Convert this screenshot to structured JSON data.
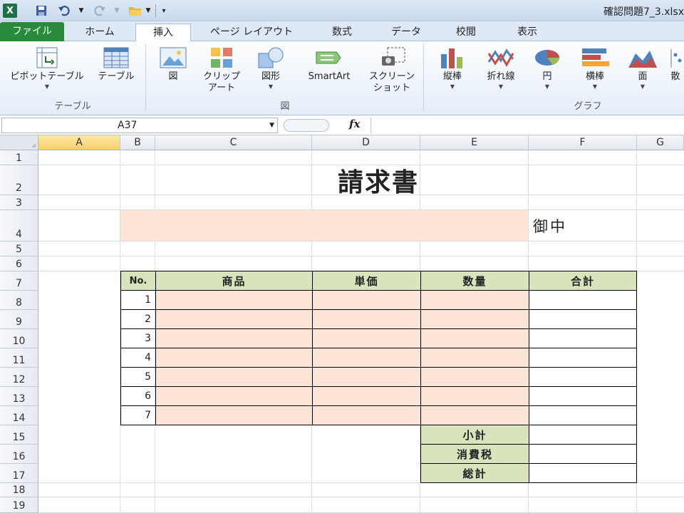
{
  "window": {
    "title": "確認問題7_3.xlsx"
  },
  "quick_access": {
    "logo": "X",
    "icons": [
      "excel-icon",
      "save-icon",
      "undo-icon",
      "redo-icon",
      "open-folder-icon"
    ]
  },
  "tabs": [
    "ファイル",
    "ホーム",
    "挿入",
    "ページ レイアウト",
    "数式",
    "データ",
    "校閲",
    "表示"
  ],
  "active_tab": "挿入",
  "ribbon": {
    "table_group": {
      "label": "テーブル",
      "pivot": "ピボットテーブル",
      "table": "テーブル"
    },
    "illust_group": {
      "label": "図",
      "picture": "図",
      "clipart": "クリップ\nアート",
      "shapes": "図形",
      "smartart": "SmartArt",
      "screenshot": "スクリーン\nショット"
    },
    "chart_group": {
      "label": "グラフ",
      "column": "縦棒",
      "line": "折れ線",
      "pie": "円",
      "bar": "横棒",
      "area": "面",
      "scatter": "散"
    }
  },
  "formula_bar": {
    "name_box": "A37",
    "fx": "fx",
    "formula": ""
  },
  "grid": {
    "columns": [
      "A",
      "B",
      "C",
      "D",
      "E",
      "F",
      "G"
    ],
    "selected_column": "A",
    "rows": [
      "1",
      "2",
      "3",
      "4",
      "5",
      "6",
      "7",
      "8",
      "9",
      "10",
      "11",
      "12",
      "13",
      "14",
      "15",
      "16",
      "17",
      "18",
      "19"
    ]
  },
  "invoice": {
    "title": "請求書",
    "recipient_suffix": "御中",
    "headers": {
      "no": "No.",
      "product": "商品",
      "unit_price": "単価",
      "quantity": "数量",
      "total": "合計"
    },
    "items": [
      "1",
      "2",
      "3",
      "4",
      "5",
      "6",
      "7"
    ],
    "summary": {
      "subtotal": "小計",
      "tax": "消費税",
      "grand_total": "総計"
    }
  },
  "colors": {
    "peach": "#fce4d6",
    "green": "#d8e4bc",
    "file_tab": "#2a8a3c"
  }
}
